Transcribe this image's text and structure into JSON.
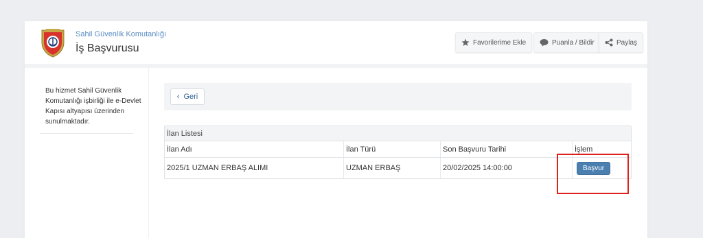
{
  "header": {
    "agency": "Sahil Güvenlik Komutanlığı",
    "title": "İş Başvurusu",
    "buttons": [
      {
        "label": "Favorilerime Ekle",
        "icon": "star-icon"
      },
      {
        "label": "Puanla / Bildir",
        "icon": "speech-bubble-icon"
      },
      {
        "label": "Paylaş",
        "icon": "share-icon"
      }
    ]
  },
  "sidebar": {
    "info": "Bu hizmet Sahil Güvenlik Komutanlığı işbirliği ile e-Devlet Kapısı altyapısı üzerinden sunulmaktadır."
  },
  "toolbar": {
    "back_label": "Geri"
  },
  "listing": {
    "caption": "İlan Listesi",
    "columns": [
      "İlan Adı",
      "İlan Türü",
      "Son Başvuru Tarihi",
      "İşlem"
    ],
    "rows": [
      {
        "name": "2025/1 UZMAN ERBAŞ ALIMI",
        "type": "UZMAN ERBAŞ",
        "deadline": "20/02/2025 14:00:00",
        "action": "Başvur"
      }
    ]
  },
  "colors": {
    "accent": "#4a7fb0",
    "agency_text": "#5b8cc4",
    "highlight": "#e0201a"
  }
}
